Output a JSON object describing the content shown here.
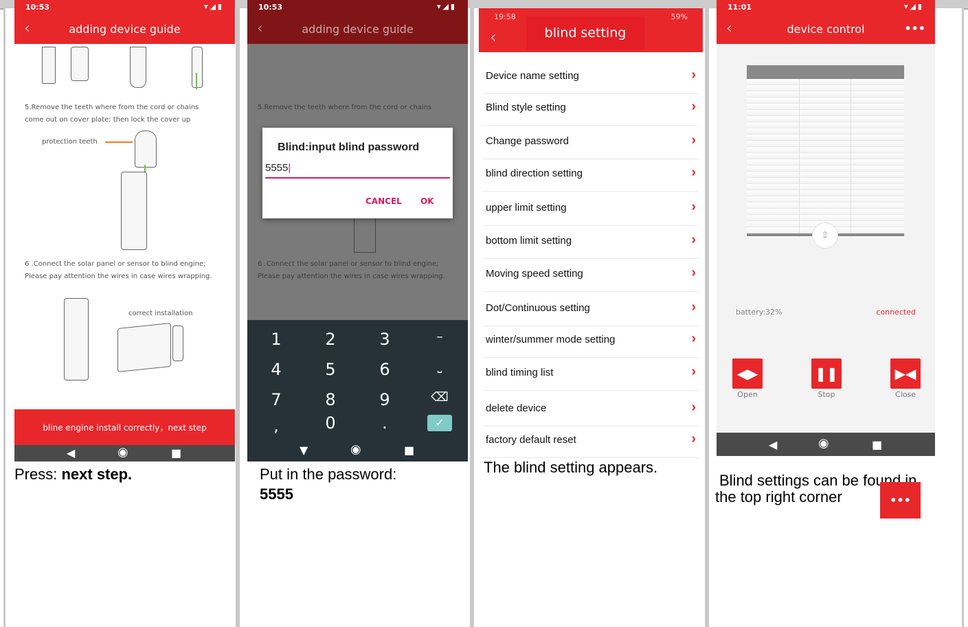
{
  "panel1": {
    "time": "10:53",
    "title": "adding device guide",
    "step5": [
      "5.Remove the teeth where from the cord or chains",
      "come out on cover plate; then lock the cover up"
    ],
    "protection_label": "protection teeth",
    "step6": [
      "6 .Connect the solar panel or sensor to blind engine;",
      "Please pay attention the wires in case wires wrapping."
    ],
    "correct_label": "correct installation",
    "next_button": "bline engine install correctly，next step",
    "caption_prefix": "Press: ",
    "caption_bold": "next step."
  },
  "panel2": {
    "time": "10:53",
    "title": "adding device guide",
    "step5": [
      "5.Remove the teeth where from the cord or chains"
    ],
    "step6": [
      "6 .Connect the solar panel or sensor to blind engine;",
      "Please pay attention the wires in case wires wrapping."
    ],
    "dialog_title": "Blind:input blind password",
    "dialog_value": "5555",
    "cancel": "CANCEL",
    "ok": "OK",
    "keys": [
      "1",
      "2",
      "3",
      "–",
      "4",
      "5",
      "6",
      "⎵",
      "7",
      "8",
      "9",
      "⌫",
      ",",
      "0",
      ".",
      "✓"
    ],
    "caption_line1": "Put in the password:",
    "caption_line2": "5555"
  },
  "panel3": {
    "time": "19:58",
    "battery": "59%",
    "title": "blind setting",
    "items": [
      "Device name setting",
      "Blind style setting",
      "Change password",
      "blind direction setting",
      "upper limit setting",
      "bottom limit setting",
      "Moving speed setting",
      "Dot/Continuous setting",
      "winter/summer mode setting",
      "blind timing list",
      "delete device",
      "factory default reset"
    ],
    "caption": "The blind setting appears."
  },
  "panel4": {
    "time": "11:01",
    "title": "device control",
    "more": "•••",
    "battery": "battery:32%",
    "status": "connected",
    "open": "Open",
    "stop": "Stop",
    "close": "Close",
    "caption_line1": "Blind settings can be found in",
    "caption_line2": "the top right corner",
    "caption_icon": "•••",
    "accent_color": "#e8272b"
  }
}
